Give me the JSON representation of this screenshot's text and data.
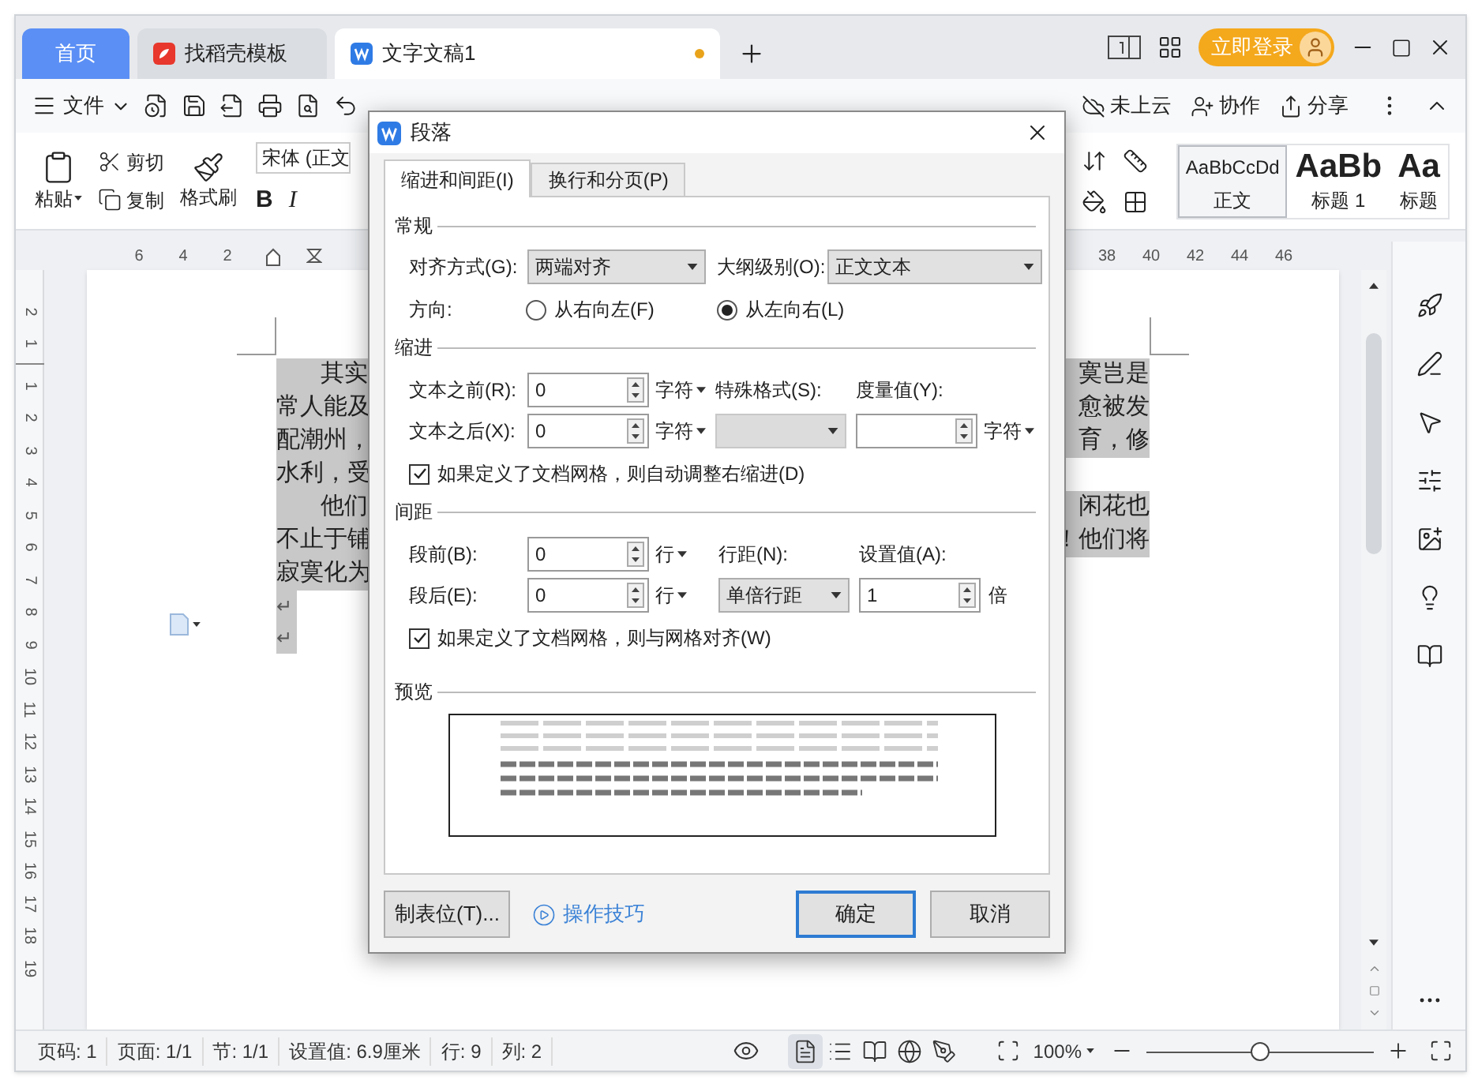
{
  "title_bar": {
    "tabs": [
      {
        "label": "首页",
        "kind": "home",
        "selected": false,
        "unsaved": false
      },
      {
        "label": "找稻壳模板",
        "kind": "template",
        "selected": false,
        "unsaved": false
      },
      {
        "label": "文字文稿1",
        "kind": "document",
        "selected": true,
        "unsaved": true
      }
    ],
    "login_button": "立即登录"
  },
  "toolbar": {
    "file_menu": "文件",
    "cloud": "未上云",
    "collaborate": "协作",
    "share": "分享"
  },
  "ribbon": {
    "paste": "粘贴",
    "cut": "剪切",
    "copy": "复制",
    "format_painter": "格式刷",
    "font": "宋体 (正文",
    "bold": "B",
    "italic": "I",
    "styles": [
      {
        "sample": "AaBbCcDd",
        "label": "正文",
        "kind": "body",
        "selected": true
      },
      {
        "sample": "AaBb",
        "label": "标题 1",
        "kind": "heading",
        "selected": false
      },
      {
        "sample": "Aa",
        "label": "标题",
        "kind": "heading",
        "selected": false
      }
    ]
  },
  "ruler": {
    "left_ticks": [
      "6",
      "4",
      "2"
    ],
    "right_ticks": [
      "38",
      "40",
      "42",
      "44",
      "46"
    ],
    "vertical_ticks_above": [
      "2",
      "1"
    ],
    "vertical_ticks": [
      "1",
      "2",
      "3",
      "4",
      "5",
      "6",
      "7",
      "8",
      "9",
      "10",
      "11",
      "12",
      "13",
      "14",
      "15",
      "16",
      "17",
      "18",
      "19"
    ]
  },
  "document": {
    "lines": [
      {
        "left": "其实",
        "right": "寞岂是",
        "indent": true
      },
      {
        "left": "常人能及",
        "right": "愈被发",
        "indent": false
      },
      {
        "left": "配潮州，",
        "right": "育，修",
        "indent": false
      },
      {
        "left": "水利，受",
        "indent": false
      },
      {
        "left": "他们",
        "right": "闲花也",
        "indent": true
      },
      {
        "left": "不止于铺",
        "right": "！他们将",
        "indent": false
      },
      {
        "left": "寂寞化为",
        "indent": false
      }
    ],
    "paragraph_marks": [
      "↵",
      "↵"
    ]
  },
  "dialog": {
    "title": "段落",
    "tabs": [
      {
        "label": "缩进和间距(I)",
        "selected": true
      },
      {
        "label": "换行和分页(P)",
        "selected": false
      }
    ],
    "general": {
      "heading": "常规",
      "alignment_label": "对齐方式(G):",
      "alignment": "两端对齐",
      "outline_label": "大纲级别(O):",
      "outline": "正文文本",
      "direction_label": "方向:",
      "directions": [
        {
          "label": "从右向左(F)",
          "selected": false
        },
        {
          "label": "从左向右(L)",
          "selected": true
        }
      ]
    },
    "indent": {
      "heading": "缩进",
      "before_label": "文本之前(R):",
      "before": "0",
      "before_unit": "字符",
      "after_label": "文本之后(X):",
      "after": "0",
      "after_unit": "字符",
      "special_label": "特殊格式(S):",
      "special_disabled": true,
      "measure_label": "度量值(Y):",
      "measure_unit": "字符",
      "auto_adjust": {
        "label": "如果定义了文档网格，则自动调整右缩进(D)",
        "checked": true
      }
    },
    "spacing": {
      "heading": "间距",
      "before_label": "段前(B):",
      "before": "0",
      "before_unit": "行",
      "after_label": "段后(E):",
      "after": "0",
      "after_unit": "行",
      "line_label": "行距(N):",
      "line": "单倍行距",
      "value_label": "设置值(A):",
      "value": "1",
      "value_unit": "倍",
      "snap": {
        "label": "如果定义了文档网格，则与网格对齐(W)",
        "checked": true
      }
    },
    "preview": {
      "heading": "预览"
    },
    "tabs_button": "制表位(T)...",
    "tips_link": "操作技巧",
    "ok": "确定",
    "cancel": "取消"
  },
  "status_bar": {
    "items": [
      "页码: 1",
      "页面: 1/1",
      "节: 1/1",
      "设置值: 6.9厘米",
      "行: 9",
      "列: 2"
    ],
    "views": [
      {
        "kind": "page",
        "selected": true
      },
      {
        "kind": "outline",
        "selected": false
      },
      {
        "kind": "reading",
        "selected": false
      },
      {
        "kind": "web",
        "selected": false
      },
      {
        "kind": "write",
        "selected": false
      }
    ],
    "zoom": "100%",
    "zoom_slider": {
      "level": 0.5
    }
  }
}
